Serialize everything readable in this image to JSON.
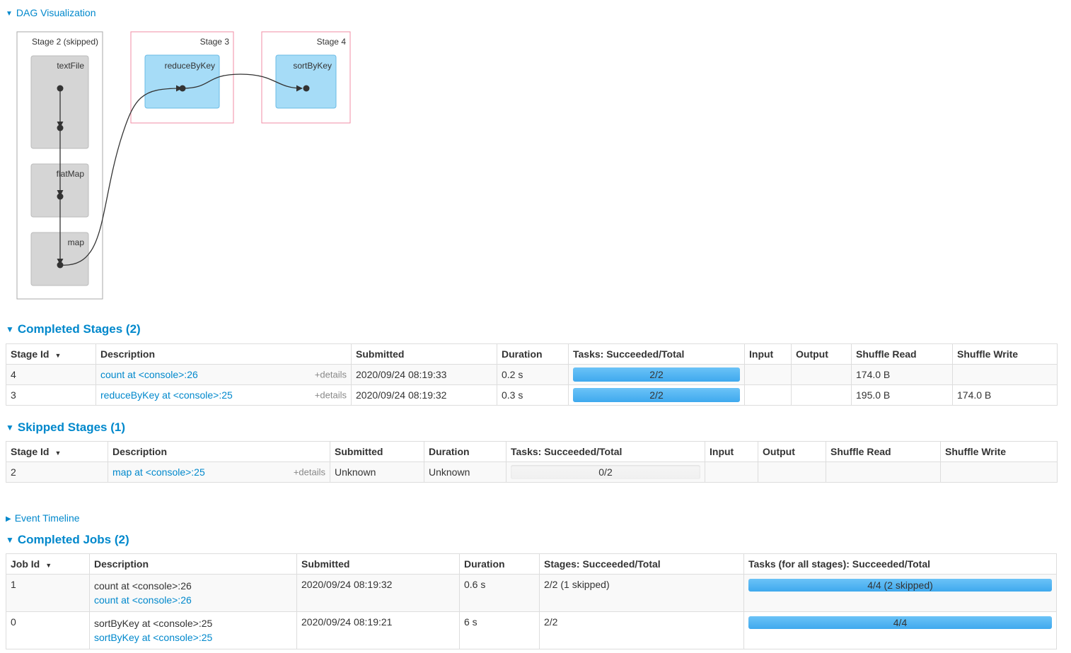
{
  "dag": {
    "toggle_label": "DAG Visualization",
    "stages": [
      {
        "title": "Stage 2 (skipped)",
        "rdds": [
          "textFile",
          "flatMap",
          "map"
        ]
      },
      {
        "title": "Stage 3",
        "rdds": [
          "reduceByKey"
        ]
      },
      {
        "title": "Stage 4",
        "rdds": [
          "sortByKey"
        ]
      }
    ]
  },
  "completed_stages": {
    "title": "Completed Stages (2)",
    "headers": [
      "Stage Id",
      "Description",
      "Submitted",
      "Duration",
      "Tasks: Succeeded/Total",
      "Input",
      "Output",
      "Shuffle Read",
      "Shuffle Write"
    ],
    "rows": [
      {
        "id": "4",
        "desc": "count at <console>:26",
        "details": "+details",
        "submitted": "2020/09/24 08:19:33",
        "duration": "0.2 s",
        "tasks": "2/2",
        "progress": 1.0,
        "input": "",
        "output": "",
        "shuffle_read": "174.0 B",
        "shuffle_write": ""
      },
      {
        "id": "3",
        "desc": "reduceByKey at <console>:25",
        "details": "+details",
        "submitted": "2020/09/24 08:19:32",
        "duration": "0.3 s",
        "tasks": "2/2",
        "progress": 1.0,
        "input": "",
        "output": "",
        "shuffle_read": "195.0 B",
        "shuffle_write": "174.0 B"
      }
    ]
  },
  "skipped_stages": {
    "title": "Skipped Stages (1)",
    "headers": [
      "Stage Id",
      "Description",
      "Submitted",
      "Duration",
      "Tasks: Succeeded/Total",
      "Input",
      "Output",
      "Shuffle Read",
      "Shuffle Write"
    ],
    "rows": [
      {
        "id": "2",
        "desc": "map at <console>:25",
        "details": "+details",
        "submitted": "Unknown",
        "duration": "Unknown",
        "tasks": "0/2",
        "progress": 0.0,
        "input": "",
        "output": "",
        "shuffle_read": "",
        "shuffle_write": ""
      }
    ]
  },
  "event_timeline": {
    "label": "Event Timeline"
  },
  "completed_jobs": {
    "title": "Completed Jobs (2)",
    "headers": [
      "Job Id",
      "Description",
      "Submitted",
      "Duration",
      "Stages: Succeeded/Total",
      "Tasks (for all stages): Succeeded/Total"
    ],
    "rows": [
      {
        "id": "1",
        "desc_text": "count at <console>:26",
        "desc_link": "count at <console>:26",
        "submitted": "2020/09/24 08:19:32",
        "duration": "0.6 s",
        "stages": "2/2 (1 skipped)",
        "tasks": "4/4 (2 skipped)",
        "progress": 1.0
      },
      {
        "id": "0",
        "desc_text": "sortByKey at <console>:25",
        "desc_link": "sortByKey at <console>:25",
        "submitted": "2020/09/24 08:19:21",
        "duration": "6 s",
        "stages": "2/2",
        "tasks": "4/4",
        "progress": 1.0
      }
    ]
  },
  "colors": {
    "link": "#0088cc",
    "progress": "#3fa9ee",
    "stage_border": "#f28ea5",
    "rdd_fill": "#a6dcf7"
  }
}
